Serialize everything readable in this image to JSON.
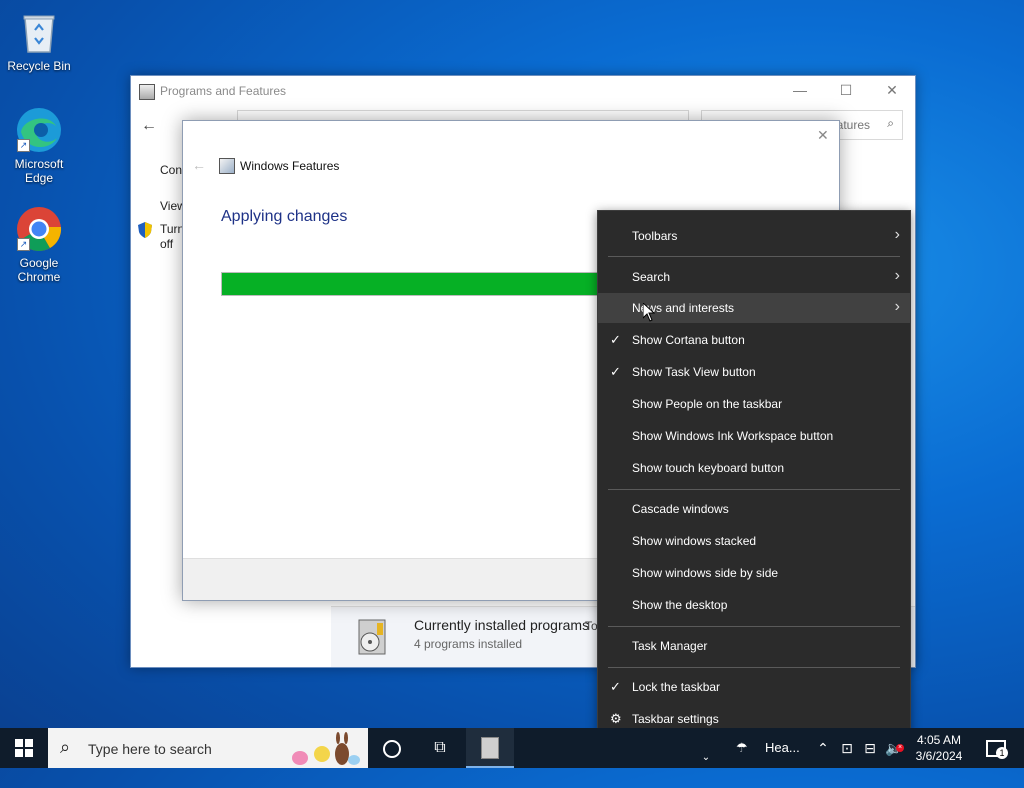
{
  "desktop": {
    "icons": [
      {
        "label": "Recycle Bin"
      },
      {
        "label": "Microsoft Edge"
      },
      {
        "label": "Google Chrome"
      }
    ]
  },
  "programs_window": {
    "title": "Programs and Features",
    "search_placeholder_visible": "atures",
    "side_links": [
      "Cont",
      "View",
      "Turn",
      "off"
    ],
    "installed_heading": "Currently installed programs",
    "installed_heading_suffix": "Tot",
    "installed_count": "4 programs installed"
  },
  "dialog": {
    "title": "Windows Features",
    "heading": "Applying changes",
    "progress": 0.65,
    "progress_color": "#06b025"
  },
  "context_menu": {
    "items": [
      {
        "label": "Toolbars",
        "submenu": true
      },
      {
        "label": "Search",
        "submenu": true
      },
      {
        "label": "News and interests",
        "submenu": true
      },
      {
        "label": "Show Cortana button",
        "checked": true
      },
      {
        "label": "Show Task View button",
        "checked": true
      },
      {
        "label": "Show People on the taskbar"
      },
      {
        "label": "Show Windows Ink Workspace button"
      },
      {
        "label": "Show touch keyboard button"
      },
      {
        "label": "Cascade windows"
      },
      {
        "label": "Show windows stacked"
      },
      {
        "label": "Show windows side by side"
      },
      {
        "label": "Show the desktop"
      },
      {
        "label": "Task Manager"
      },
      {
        "label": "Lock the taskbar",
        "checked": true
      },
      {
        "label": "Taskbar settings",
        "icon": "gear-icon"
      }
    ]
  },
  "taskbar": {
    "search_placeholder": "Type here to search",
    "weather_text": "Hea...",
    "time": "4:05 AM",
    "date": "3/6/2024",
    "notification_count": "1"
  }
}
